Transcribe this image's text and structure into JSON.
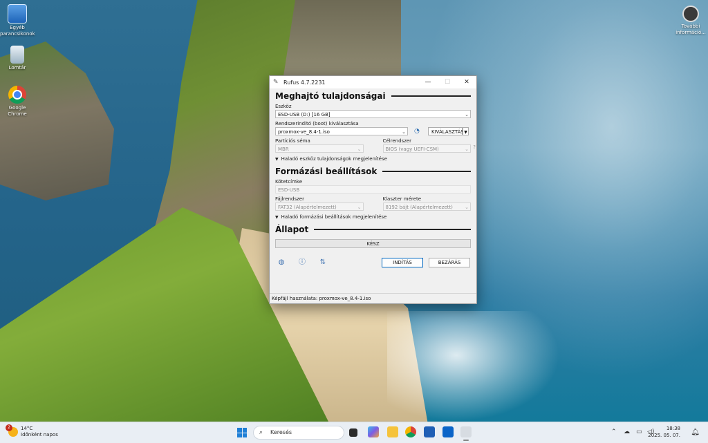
{
  "desktop": {
    "icons": [
      {
        "label": "Egyéb parancsikonok",
        "icon": "control-panel-icon"
      },
      {
        "label": "Lomtár",
        "icon": "recycle-bin-icon"
      },
      {
        "label": "Google Chrome",
        "icon": "chrome-icon"
      },
      {
        "label": "További információ...",
        "icon": "info-icon"
      }
    ]
  },
  "window": {
    "title": "Rufus 4.7.2231",
    "min": "—",
    "max": "☐",
    "close": "✕"
  },
  "drive_section": {
    "title": "Meghajtó tulajdonságai",
    "device_label": "Eszköz",
    "device_value": "ESD-USB (D:) [16 GB]",
    "boot_label": "Rendszerindító (boot) kiválasztása",
    "boot_value": "proxmox-ve_8.4-1.iso",
    "select_button": "KIVÁLASZTÁS",
    "partition_label": "Partíciós séma",
    "partition_value": "MBR",
    "target_label": "Célrendszer",
    "target_value": "BIOS (vagy UEFI-CSM)",
    "advanced_toggle": "Haladó eszköz tulajdonságok megjelenítése"
  },
  "format_section": {
    "title": "Formázási beállítások",
    "volume_label": "Kötetcímke",
    "volume_value": "ESD-USB",
    "fs_label": "Fájlrendszer",
    "fs_value": "FAT32 (Alapértelmezett)",
    "cluster_label": "Klaszter mérete",
    "cluster_value": "8192 bájt (Alapértelmezett)",
    "advanced_toggle": "Haladó formázási beállítások megjelenítése"
  },
  "status_section": {
    "title": "Állapot",
    "progress_text": "KÉSZ",
    "progress_fraction": 0
  },
  "actions": {
    "start": "INDÍTÁS",
    "close": "BEZÁRÁS"
  },
  "statusbar": {
    "text": "Képfájl használata: proxmox-ve_8.4-1.iso"
  },
  "taskbar": {
    "weather_temp": "14°C",
    "weather_desc": "Időnként napos",
    "weather_badge": "2",
    "search_placeholder": "Keresés",
    "time": "18:38",
    "date": "2025. 05. 07.",
    "tray_chevron": "⌃"
  },
  "colors": {
    "accent": "#0067c0",
    "taskbar_bg": "#e9eef4",
    "window_bg": "#f0f0f0"
  }
}
